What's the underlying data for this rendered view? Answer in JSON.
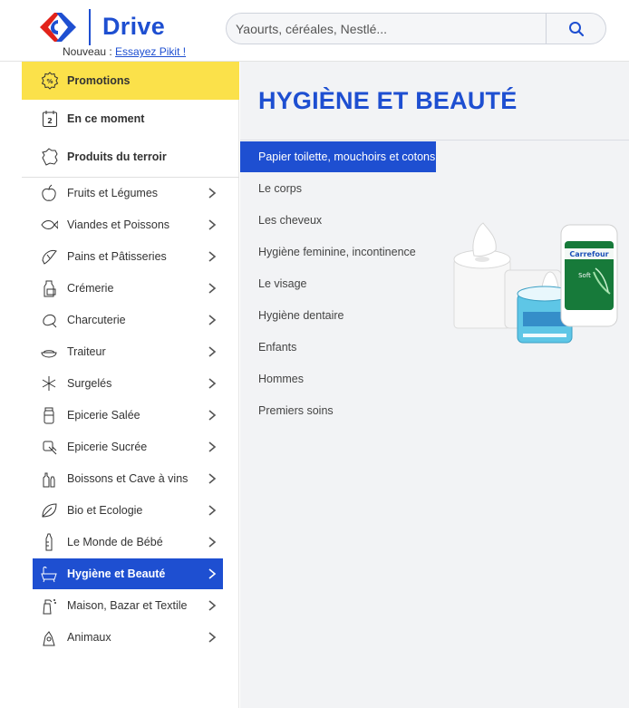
{
  "header": {
    "brand": "Drive",
    "nouveau_label": "Nouveau :",
    "nouveau_link": "Essayez Pikit !",
    "search_placeholder": "Yaourts, céréales, Nestlé..."
  },
  "sidebar": {
    "top_items": [
      {
        "label": "Promotions",
        "icon": "percent-badge-icon"
      },
      {
        "label": "En ce moment",
        "icon": "calendar-icon"
      },
      {
        "label": "Produits du terroir",
        "icon": "france-map-icon"
      }
    ],
    "categories": [
      {
        "label": "Fruits et Légumes",
        "icon": "apple-icon"
      },
      {
        "label": "Viandes et Poissons",
        "icon": "fish-icon"
      },
      {
        "label": "Pains et Pâtisseries",
        "icon": "croissant-icon"
      },
      {
        "label": "Crémerie",
        "icon": "milk-bottle-icon"
      },
      {
        "label": "Charcuterie",
        "icon": "ham-icon"
      },
      {
        "label": "Traiteur",
        "icon": "dish-icon"
      },
      {
        "label": "Surgelés",
        "icon": "snowflake-icon"
      },
      {
        "label": "Epicerie Salée",
        "icon": "jar-icon"
      },
      {
        "label": "Epicerie Sucrée",
        "icon": "candy-icon"
      },
      {
        "label": "Boissons et Cave à vins",
        "icon": "bottles-icon"
      },
      {
        "label": "Bio et Ecologie",
        "icon": "leaf-icon"
      },
      {
        "label": "Le Monde de Bébé",
        "icon": "baby-bottle-icon"
      },
      {
        "label": "Hygiène et Beauté",
        "icon": "bathtub-icon",
        "active": true
      },
      {
        "label": "Maison, Bazar et Textile",
        "icon": "spray-icon"
      },
      {
        "label": "Animaux",
        "icon": "pets-icon"
      }
    ]
  },
  "main": {
    "title": "HYGIÈNE ET BEAUTÉ",
    "subcategories": [
      "Papier toilette, mouchoirs et cotons",
      "Le corps",
      "Les cheveux",
      "Hygiène feminine, incontinence",
      "Le visage",
      "Hygiène dentaire",
      "Enfants",
      "Hommes",
      "Premiers soins"
    ],
    "product_image": {
      "brand_text": "Carrefour",
      "pack_text": "Soft"
    }
  },
  "colors": {
    "brand_blue": "#1e4fd1",
    "promo_yellow": "#fbe14a",
    "brand_red": "#e2231a"
  }
}
